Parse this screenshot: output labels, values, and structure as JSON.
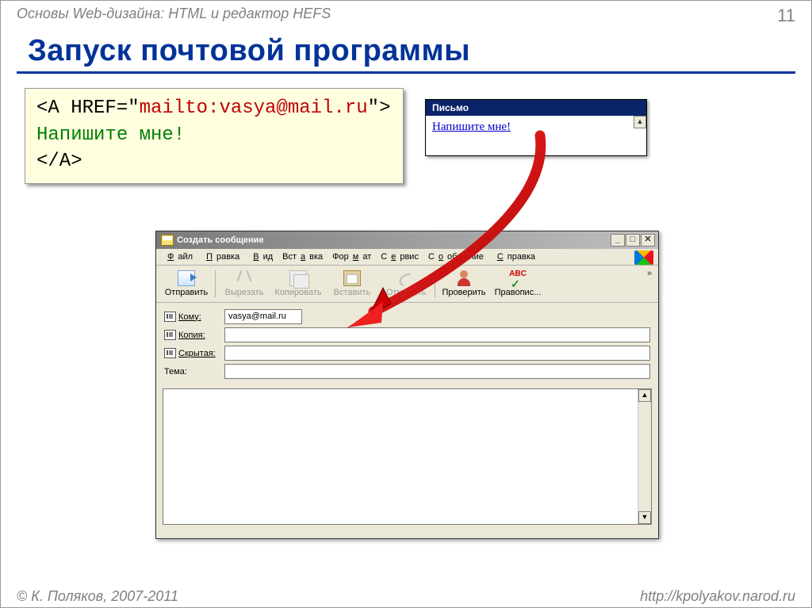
{
  "header": {
    "subject": "Основы Web-дизайна: HTML и редактор HEFS",
    "page": "11"
  },
  "title": "Запуск почтовой программы",
  "code": {
    "line1a": "<A HREF=\"",
    "line1b": "mailto:vasya@mail.ru",
    "line1c": "\">",
    "line2": "Напишите мне!",
    "line3": "</A>"
  },
  "preview": {
    "title": "Письмо",
    "link": "Напишите мне!"
  },
  "compose": {
    "title": "Создать сообщение",
    "menu": [
      "Файл",
      "Правка",
      "Вид",
      "Вставка",
      "Формат",
      "Сервис",
      "Сообщение",
      "Справка"
    ],
    "toolbar": {
      "send": "Отправить",
      "cut": "Вырезать",
      "copy": "Копировать",
      "paste": "Вставить",
      "undo": "Отменить",
      "check": "Проверить",
      "spell": "Правопис..."
    },
    "fields": {
      "to_label": "Кому:",
      "to_value": "vasya@mail.ru",
      "cc_label": "Копия:",
      "bcc_label": "Скрытая:",
      "subj_label": "Тема:"
    }
  },
  "footer": {
    "copyright": "© К. Поляков, 2007-2011",
    "url": "http://kpolyakov.narod.ru"
  }
}
